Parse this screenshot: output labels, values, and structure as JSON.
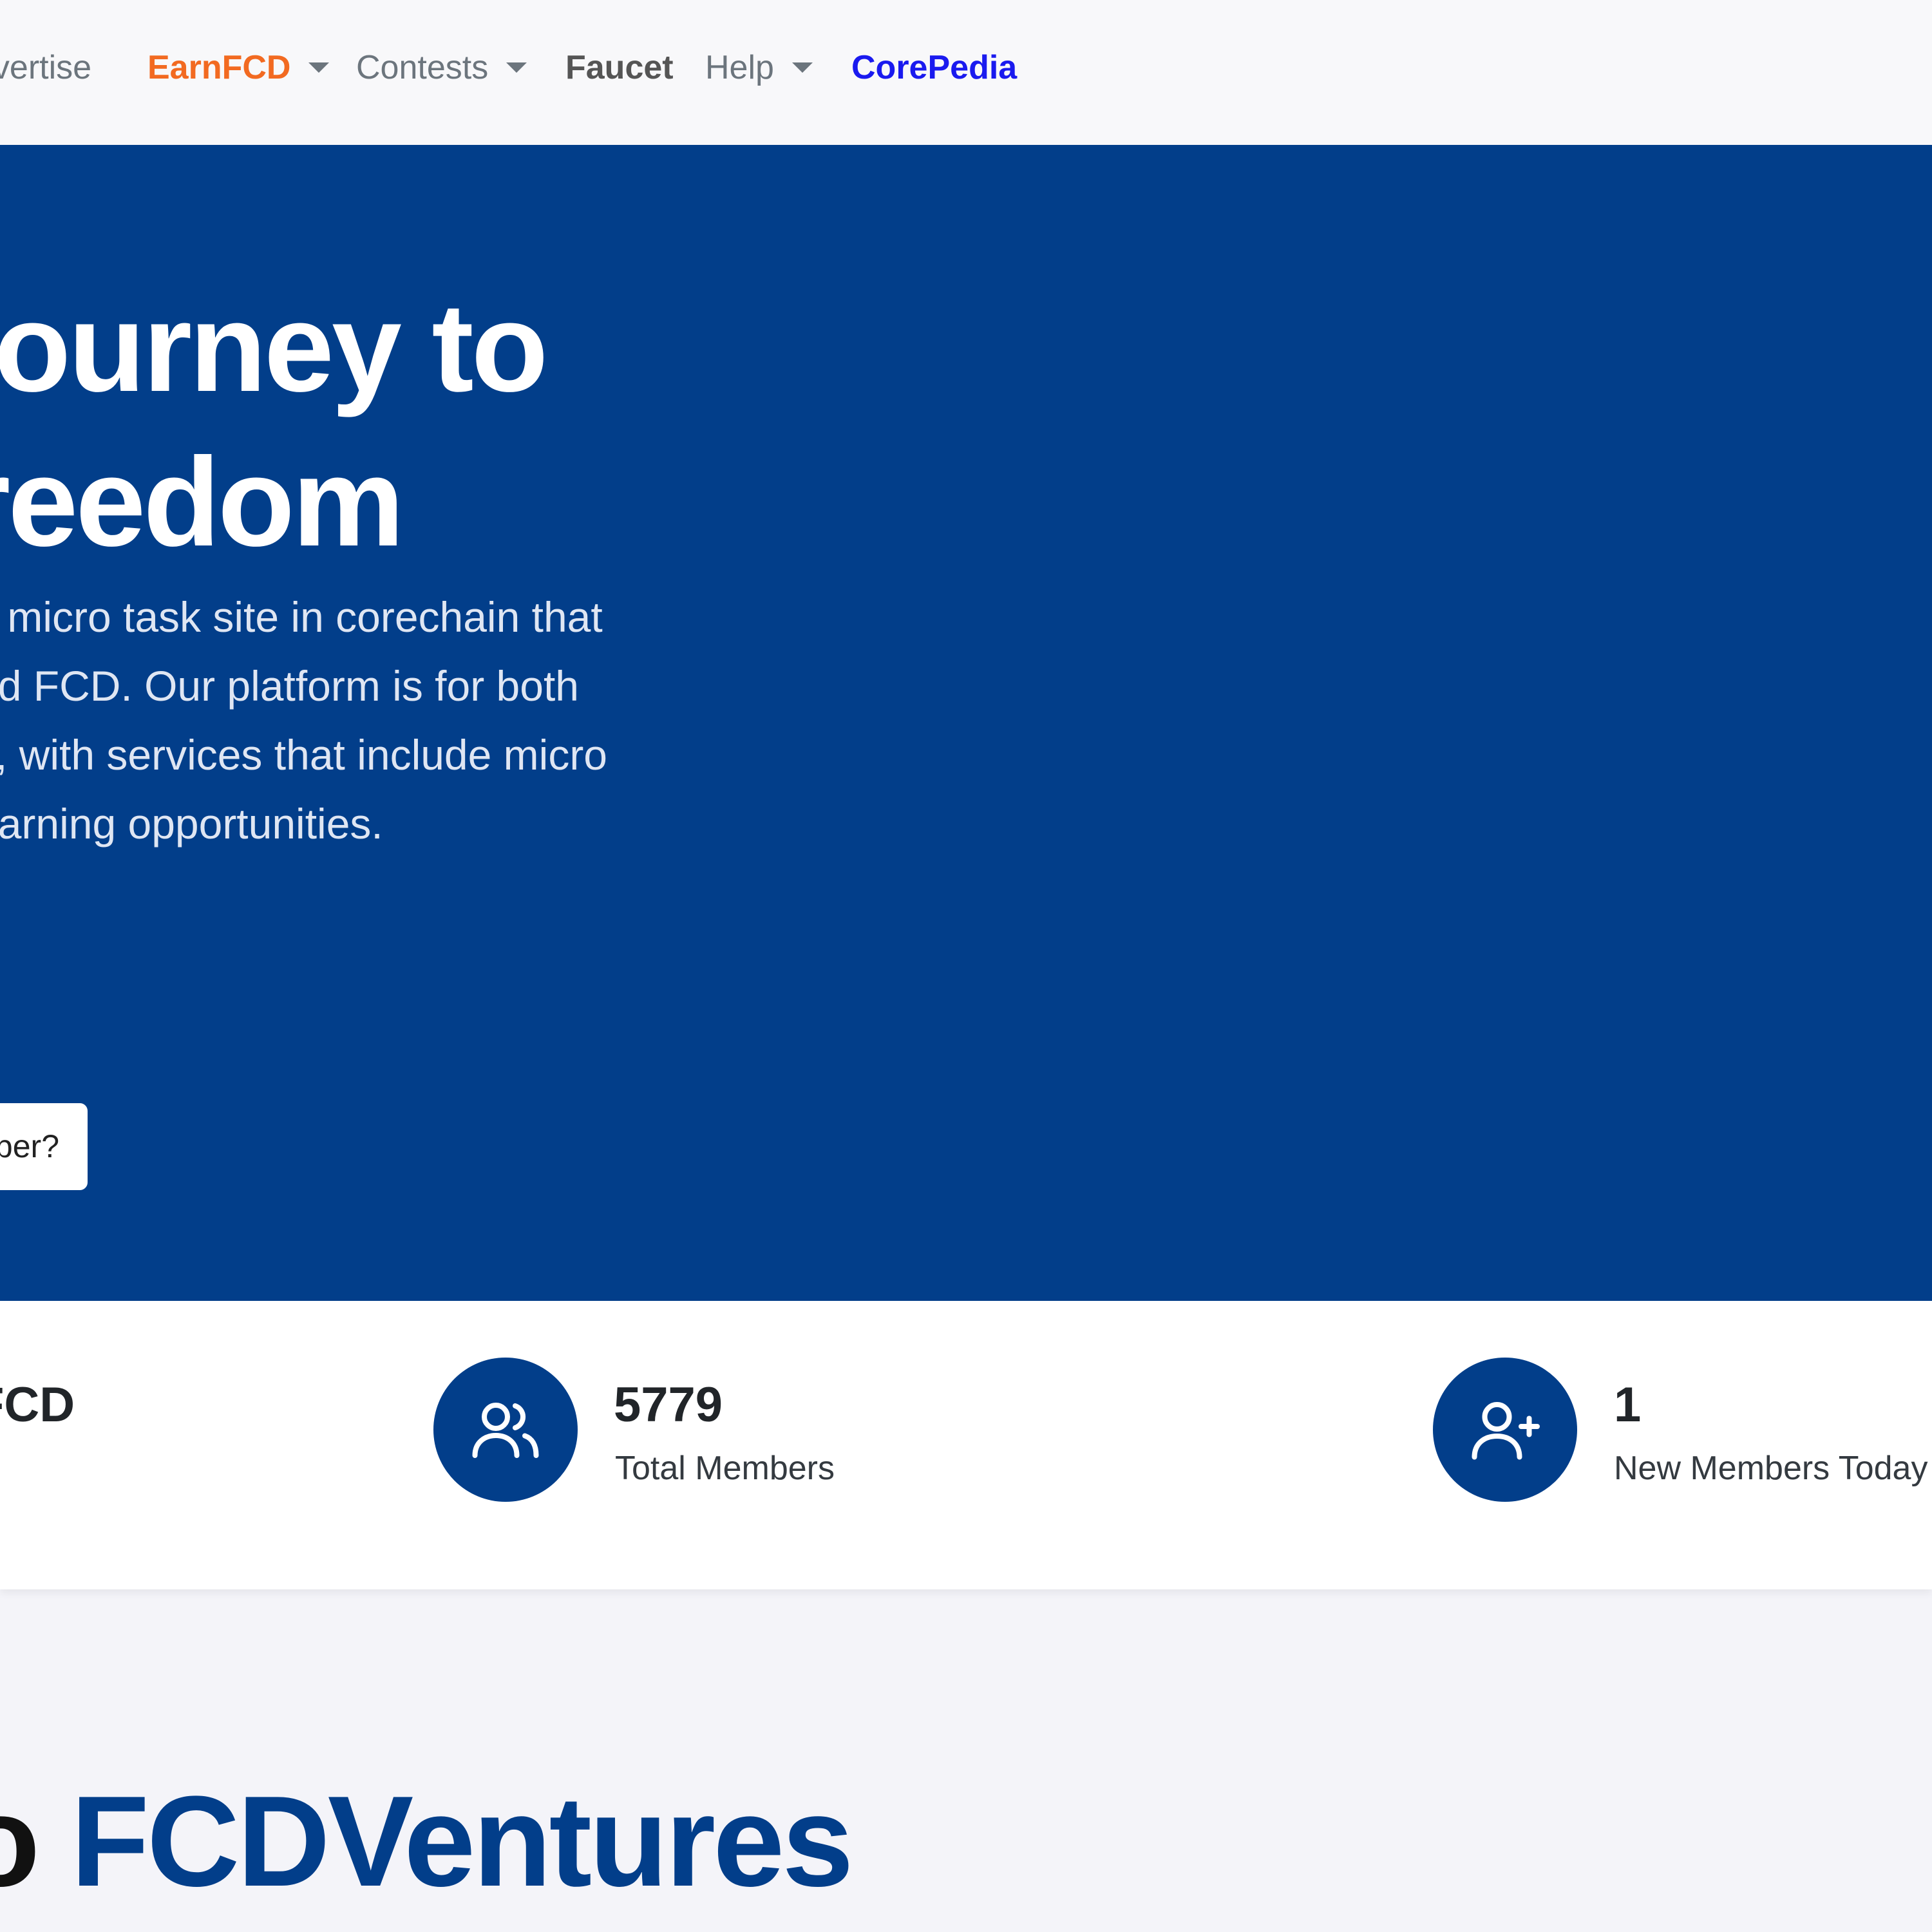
{
  "nav": {
    "items": [
      {
        "label": "dvertise"
      },
      {
        "label": "EarnFCD"
      },
      {
        "label": "Contests"
      },
      {
        "label": "Faucet"
      },
      {
        "label": "Help"
      },
      {
        "label": "CorePedia"
      }
    ]
  },
  "hero": {
    "title_lines": [
      "journey to",
      "reedom"
    ],
    "desc_lines": [
      "y micro task site in corechain that",
      "nd FCD. Our platform is for both",
      "s, with services that include micro",
      "earning opportunities."
    ],
    "button_label": "per?"
  },
  "stats": {
    "partial_value": "FCD",
    "items": [
      {
        "value": "5779",
        "label": "Total Members",
        "icon": "users-icon"
      },
      {
        "value": "1",
        "label": "New Members Today",
        "icon": "user-plus-icon"
      }
    ]
  },
  "welcome": {
    "prefix": "o ",
    "brand": "FCDVentures"
  },
  "colors": {
    "primary": "#023e8a",
    "earn": "#f26a21",
    "corepedia": "#1a1aef"
  }
}
